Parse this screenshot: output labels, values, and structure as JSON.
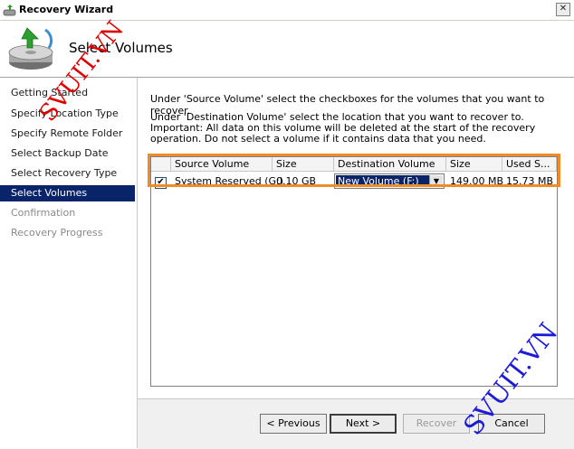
{
  "window": {
    "title": "Recovery Wizard",
    "close_glyph": "✕"
  },
  "header": {
    "heading": "Select Volumes",
    "icon": "backup-disk-icon"
  },
  "sidebar": {
    "items": [
      {
        "label": "Getting Started",
        "state": "normal"
      },
      {
        "label": "Specify Location Type",
        "state": "normal"
      },
      {
        "label": "Specify Remote Folder",
        "state": "normal"
      },
      {
        "label": "Select Backup Date",
        "state": "normal"
      },
      {
        "label": "Select Recovery Type",
        "state": "normal"
      },
      {
        "label": "Select Volumes",
        "state": "active"
      },
      {
        "label": "Confirmation",
        "state": "disabled"
      },
      {
        "label": "Recovery Progress",
        "state": "disabled"
      }
    ]
  },
  "content": {
    "instruction1": "Under 'Source Volume' select the checkboxes for the volumes that you want to recover.",
    "instruction2": "Under 'Destination Volume' select the location that you want to recover to. Important: All data on this volume will be deleted at the start of the recovery operation. Do not select a volume if it contains data that you need."
  },
  "grid": {
    "columns": [
      "Source Volume",
      "Size",
      "Destination Volume",
      "Size",
      "Used S..."
    ],
    "rows": [
      {
        "checked": true,
        "check_glyph": "✔",
        "source": "System Reserved (G:)",
        "size": "0.10 GB",
        "destination": "New Volume (F:)",
        "dest_size": "149.00 MB",
        "used": "15.73 MB"
      }
    ]
  },
  "footer": {
    "previous_label": "< Previous",
    "next_label": "Next >",
    "recover_label": "Recover",
    "cancel_label": "Cancel"
  },
  "watermark": {
    "text_top": "SVUIT.VN",
    "text_bottom": "SVUIT.VN"
  },
  "colors": {
    "selection": "#0a246a",
    "highlight_outline": "#f08c28",
    "watermark_red": "#e00000",
    "watermark_blue": "#1c1cd8"
  }
}
